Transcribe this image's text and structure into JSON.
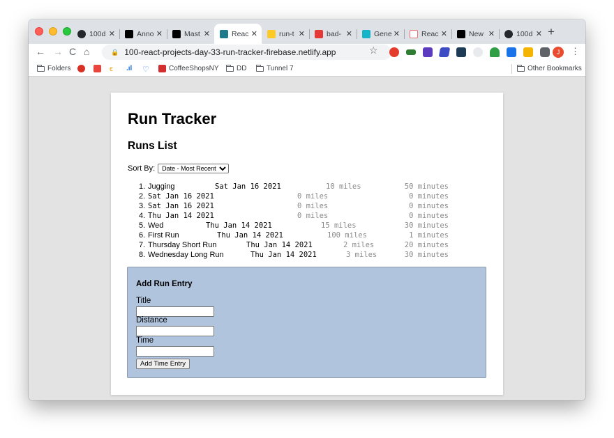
{
  "browser": {
    "tabs": [
      {
        "title": "100d",
        "favicon": "github-icon",
        "color": "#24292e"
      },
      {
        "title": "Anno",
        "favicon": "dev-icon",
        "color": "#000000"
      },
      {
        "title": "Mast",
        "favicon": "dev-icon",
        "color": "#000000"
      },
      {
        "title": "Reac",
        "favicon": "react-icon",
        "color": "#1f7a8c",
        "active": true
      },
      {
        "title": "run-t",
        "favicon": "firebase-icon",
        "color": "#ffca28"
      },
      {
        "title": "bad-",
        "favicon": "netlify-badge-icon",
        "color": "#e53935"
      },
      {
        "title": "Gene",
        "favicon": "diamond-icon",
        "color": "#16b4c8"
      },
      {
        "title": "Reac",
        "favicon": "runner-icon",
        "color": "#ffffff"
      },
      {
        "title": "New",
        "favicon": "dev-icon",
        "color": "#000000"
      },
      {
        "title": "100d",
        "favicon": "github-icon",
        "color": "#24292e"
      }
    ],
    "url": "100-react-projects-day-33-run-tracker-firebase.netlify.app",
    "avatar_letter": "J",
    "bookmarks": {
      "folders": "Folders",
      "coffee": "CoffeeShopsNY",
      "dd": "DD",
      "tunnel": "Tunnel 7",
      "other": "Other Bookmarks"
    }
  },
  "page": {
    "title": "Run Tracker",
    "list_heading": "Runs List",
    "sort_label": "Sort By:",
    "sort_selected": "Date - Most Recent",
    "runs": [
      {
        "n": "1.",
        "title": "Jugging",
        "date": "Sat Jan 16 2021",
        "distance": "10 miles",
        "time": "50 minutes"
      },
      {
        "n": "2.",
        "title": "",
        "date": "Sat Jan 16 2021",
        "distance": "0 miles",
        "time": "0 minutes"
      },
      {
        "n": "3.",
        "title": "",
        "date": "Sat Jan 16 2021",
        "distance": "0 miles",
        "time": "0 minutes"
      },
      {
        "n": "4.",
        "title": "",
        "date": "Thu Jan 14 2021",
        "distance": "0 miles",
        "time": "0 minutes"
      },
      {
        "n": "5.",
        "title": "Wed",
        "date": "Thu Jan 14 2021",
        "distance": "15 miles",
        "time": "30 minutes"
      },
      {
        "n": "6.",
        "title": "First Run",
        "date": "Thu Jan 14 2021",
        "distance": "100 miles",
        "time": "1 minutes"
      },
      {
        "n": "7.",
        "title": "Thursday Short Run",
        "date": "Thu Jan 14 2021",
        "distance": "2 miles",
        "time": "20 minutes"
      },
      {
        "n": "8.",
        "title": "Wednesday Long Run",
        "date": "Thu Jan 14 2021",
        "distance": "3 miles",
        "time": "30 minutes"
      }
    ],
    "form": {
      "heading": "Add Run Entry",
      "title_label": "Title",
      "title_value": "",
      "distance_label": "Distance",
      "distance_value": "",
      "time_label": "Time",
      "time_value": "",
      "submit_label": "Add Time Entry"
    }
  }
}
